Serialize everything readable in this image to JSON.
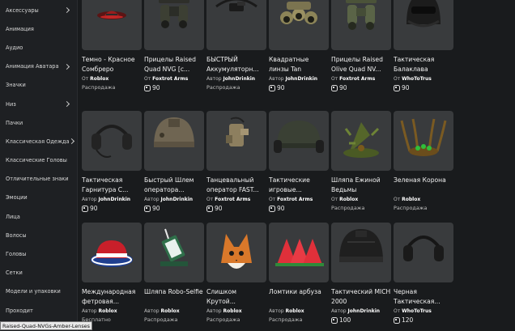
{
  "sidebar": {
    "items": [
      {
        "label": "Аксессуары",
        "chevron": true
      },
      {
        "label": "Анимация",
        "chevron": false
      },
      {
        "label": "Аудио",
        "chevron": false
      },
      {
        "label": "Анимация Аватара",
        "chevron": true
      },
      {
        "label": "Значки",
        "chevron": false
      },
      {
        "label": "Низ",
        "chevron": true
      },
      {
        "label": "Пачки",
        "chevron": false
      },
      {
        "label": "Классическая Одежда",
        "chevron": true
      },
      {
        "label": "Классические Головы",
        "chevron": false
      },
      {
        "label": "Отличительные знаки",
        "chevron": false
      },
      {
        "label": "Эмоции",
        "chevron": false
      },
      {
        "label": "Лица",
        "chevron": false
      },
      {
        "label": "Волосы",
        "chevron": false
      },
      {
        "label": "Головы",
        "chevron": false
      },
      {
        "label": "Сетки",
        "chevron": false
      },
      {
        "label": "Модели и упаковки",
        "chevron": false
      },
      {
        "label": "Проходит",
        "chevron": false
      }
    ]
  },
  "items": [
    {
      "title": "Темно - Красное Сомбреро",
      "by": "От",
      "creator": "Roblox",
      "status": "Распродажа",
      "price": "",
      "icon": "red-sombrero"
    },
    {
      "title": "Прицелы Raised Quad NVG [с...",
      "by": "От",
      "creator": "Foxtrot Arms",
      "status": "",
      "price": "90",
      "icon": "nvg-goggles"
    },
    {
      "title": "БЫСТРЫЙ Аккумуляторн...",
      "by": "Автор",
      "creator": "JohnDrinkin",
      "status": "Распродажа",
      "price": "",
      "icon": "battery-headset"
    },
    {
      "title": "Квадратные линзы Tan",
      "by": "Автор",
      "creator": "JohnDrinkin",
      "status": "",
      "price": "90",
      "icon": "tan-lenses"
    },
    {
      "title": "Прицелы Raised Olive Quad NV...",
      "by": "От",
      "creator": "Foxtrot Arms",
      "status": "",
      "price": "90",
      "icon": "olive-nvg"
    },
    {
      "title": "Тактическая Балаклава",
      "by": "От",
      "creator": "WhoToTrus",
      "status": "",
      "price": "90",
      "icon": "balaclava"
    },
    {
      "title": "Тактическая Гарнитура С...",
      "by": "Автор",
      "creator": "JohnDrinkin",
      "status": "",
      "price": "90",
      "icon": "tactical-headset"
    },
    {
      "title": "Быстрый Шлем оператора...",
      "by": "Автор",
      "creator": "JohnDrinkin",
      "status": "",
      "price": "90",
      "icon": "operator-helmet"
    },
    {
      "title": "Танцевальный оператор FAST...",
      "by": "От",
      "creator": "Foxtrot Arms",
      "status": "",
      "price": "90",
      "icon": "fast-gear"
    },
    {
      "title": "Тактические игровые...",
      "by": "От",
      "creator": "Foxtrot Arms",
      "status": "",
      "price": "90",
      "icon": "gaming-headset"
    },
    {
      "title": "Шляпа Ежиной Ведьмы",
      "by": "От",
      "creator": "Roblox",
      "status": "Распродажа",
      "price": "",
      "icon": "witch-hat"
    },
    {
      "title": "Зеленая Корона",
      "by": "От",
      "creator": "Roblox",
      "status": "Распродажа",
      "price": "",
      "icon": "green-crown"
    },
    {
      "title": "Международная фетровая...",
      "by": "Автор",
      "creator": "Roblox",
      "status": "Бесплатно",
      "price": "",
      "icon": "fedora"
    },
    {
      "title": "Шляпа Robo-Selfie",
      "by": "Автор",
      "creator": "Roblox",
      "status": "Распродажа",
      "price": "",
      "icon": "robo-selfie-hat"
    },
    {
      "title": "Слишком Крутой...",
      "by": "Автор",
      "creator": "Roblox",
      "status": "Распродажа",
      "price": "",
      "icon": "fox-hat"
    },
    {
      "title": "Ломтики арбуза",
      "by": "Автор",
      "creator": "Roblox",
      "status": "Распродажа",
      "price": "",
      "icon": "watermelon"
    },
    {
      "title": "Тактический MICH 2000",
      "by": "Автор",
      "creator": "JohnDrinkin",
      "status": "",
      "price": "100",
      "icon": "mich-helmet"
    },
    {
      "title": "Черная Тактическая...",
      "by": "От",
      "creator": "WhoToTrus",
      "status": "",
      "price": "120",
      "icon": "black-headset"
    }
  ],
  "tooltip": "Raised-Quad-NVGs-Amber-Lenses"
}
